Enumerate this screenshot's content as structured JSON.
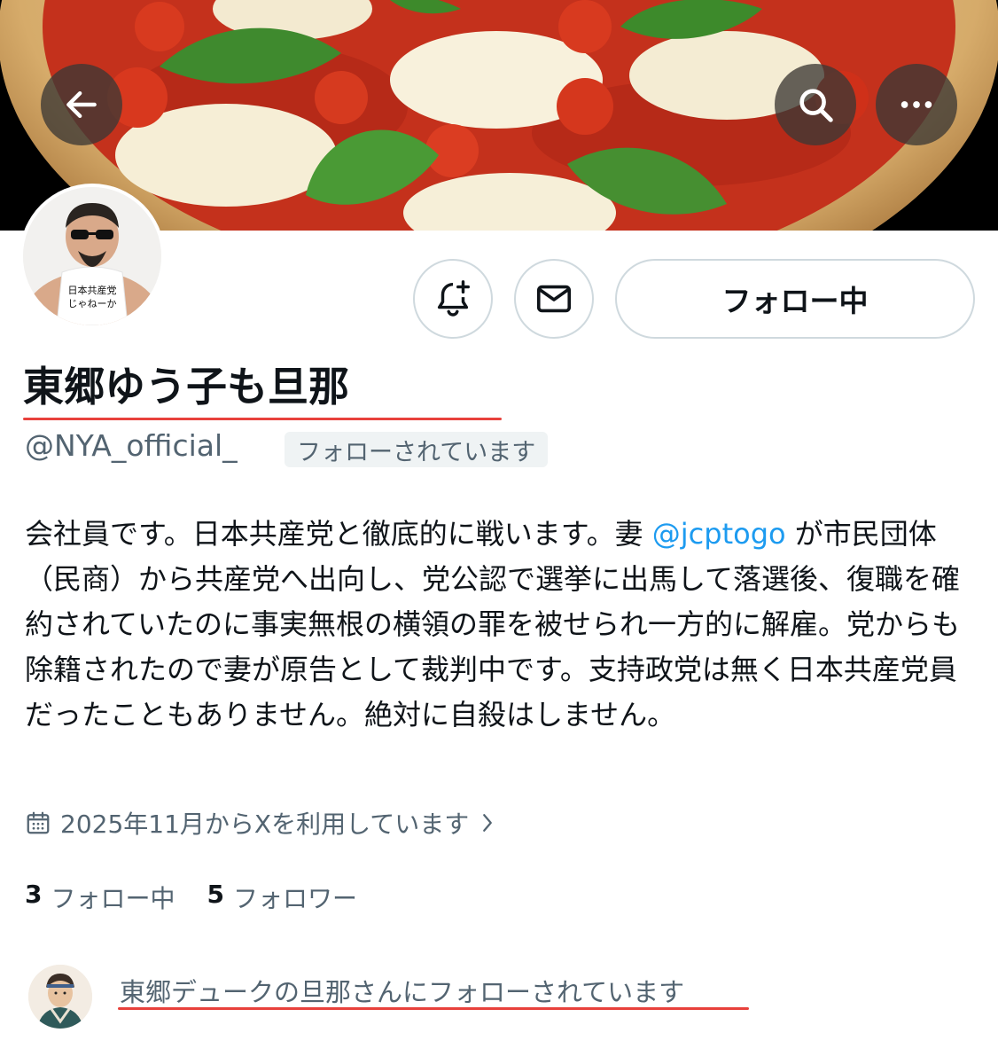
{
  "header": {
    "back_icon": "arrow-left-icon",
    "search_icon": "search-icon",
    "more_icon": "more-horizontal-icon"
  },
  "profile": {
    "display_name": "東郷ゆう子も旦那",
    "handle": "@NYA_official_",
    "follows_you_badge": "フォローされています",
    "avatar_shirt_text": "日本共産党じゃねーか",
    "follow_button_label": "フォロー中",
    "notify_icon": "bell-plus-icon",
    "message_icon": "envelope-icon",
    "bio_before_mention": "会社員です。日本共産党と徹底的に戦います。妻 ",
    "bio_mention": "@jcptogo",
    "bio_after_mention": " が市民団体（民商）から共産党へ出向し、党公認で選挙に出馬して落選後、復職を確約されていたのに事実無根の横領の罪を被せられ一方的に解雇。党からも除籍されたので妻が原告として裁判中です。支持政党は無く日本共産党員だったこともありません。絶対に自殺はしません。",
    "joined_text": "2025年11月からXを利用しています",
    "joined_icon": "calendar-icon",
    "chevron_icon": "chevron-right-icon"
  },
  "stats": {
    "following_count": "3",
    "following_label": "フォロー中",
    "followers_count": "5",
    "followers_label": "フォロワー"
  },
  "followed_by": {
    "text": "東郷デュークの旦那さんにフォローされています"
  },
  "colors": {
    "link": "#1d9bf0",
    "secondary_text": "#536471",
    "primary_text": "#0f1419",
    "annotation_underline": "#e8413c",
    "border": "#cfd9de"
  }
}
